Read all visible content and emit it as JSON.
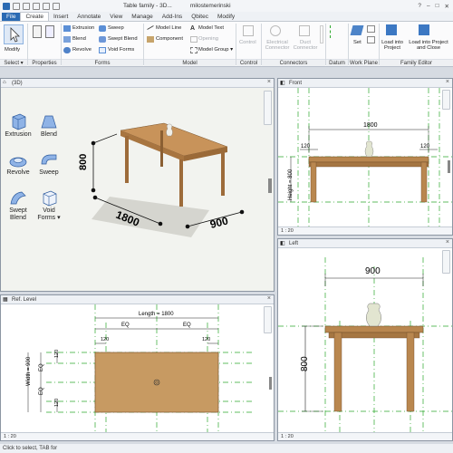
{
  "titlebar": {
    "doc_title": "Table family - 3D...",
    "user": "milostemerinski"
  },
  "tabs": [
    "File",
    "Create",
    "Insert",
    "Annotate",
    "View",
    "Manage",
    "Add-Ins",
    "Qbitec",
    "Modify"
  ],
  "ribbon": {
    "modify_label": "Modify",
    "select_label": "Select",
    "properties_group": "Properties",
    "forms": {
      "extrusion": "Extrusion",
      "blend": "Blend",
      "revolve": "Revolve",
      "sweep": "Sweep",
      "swept_blend": "Swept Blend",
      "void_forms": "Void Forms",
      "group_label": "Forms"
    },
    "model": {
      "model_line": "Model  Line",
      "model_text": "Model  Text",
      "component": "Component",
      "opening": "Opening",
      "model_group": "Model  Group",
      "group_label": "Model"
    },
    "control": {
      "control": "Control",
      "group_label": "Control"
    },
    "connectors": {
      "electrical": "Electrical Connector",
      "duct": "Duct Connector",
      "group_label": "Connectors"
    },
    "datum": {
      "group_label": "Datum"
    },
    "work_plane": {
      "set": "Set",
      "group_label": "Work Plane"
    },
    "family_editor": {
      "load_into_project": "Load into Project",
      "load_and_close": "Load into Project and Close",
      "group_label": "Family Editor"
    }
  },
  "views": {
    "v3d": {
      "title": "(3D)",
      "dim_length": "1800",
      "dim_width": "900",
      "dim_height": "800",
      "forms": [
        "Extrusion",
        "Blend",
        "Revolve",
        "Sweep",
        "Swept Blend",
        "Void Forms"
      ]
    },
    "front": {
      "title": "Front",
      "dim_length": "1800",
      "dim_left": "120",
      "dim_right": "120",
      "height_label": "Height = 800",
      "scale": "1 : 20"
    },
    "left": {
      "title": "Left",
      "dim_width": "900",
      "dim_height": "800",
      "scale": "1 : 20"
    },
    "ref_level": {
      "title": "Ref. Level",
      "length_label": "Length = 1800",
      "eq1": "EQ",
      "eq2": "EQ",
      "eq3": "EQ",
      "eq4": "EQ",
      "width_label": "Width = 900",
      "d120a": "120",
      "d120b": "120",
      "d120c": "120",
      "d120d": "120",
      "scale": "1 : 20"
    }
  },
  "status": "Click to select, TAB for",
  "colors": {
    "accent": "#2a6ab3",
    "wood": "#b9874f",
    "ref_green": "#2da82d",
    "dim_blue": "#1a3c8c"
  }
}
